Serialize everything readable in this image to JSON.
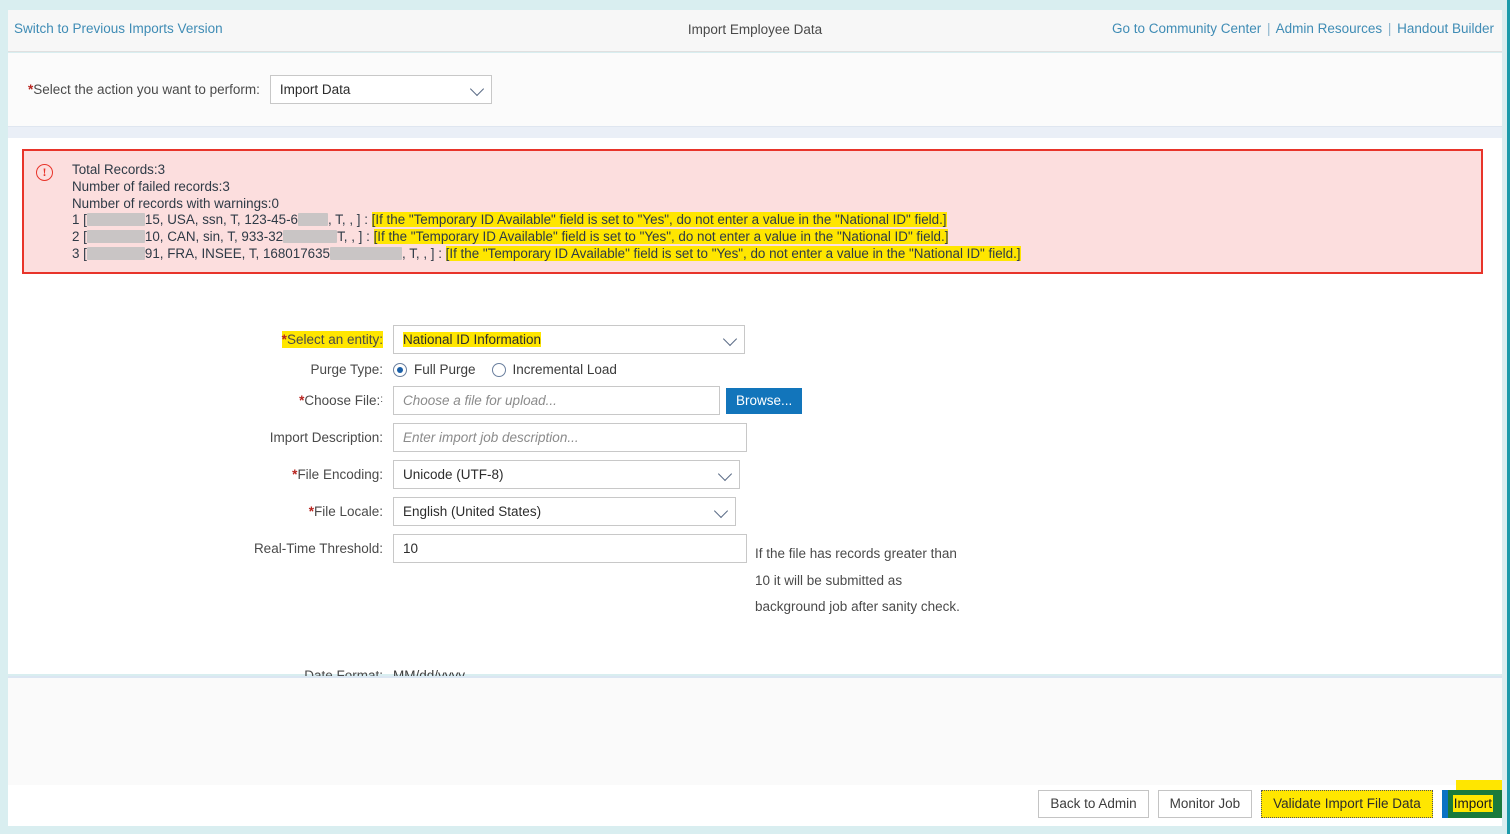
{
  "header": {
    "switch_version_label": "Switch to Previous Imports Version",
    "title": "Import Employee Data",
    "links": [
      {
        "label": "Go to Community Center"
      },
      {
        "label": "Admin Resources"
      },
      {
        "label": "Handout Builder"
      }
    ],
    "separator": "|"
  },
  "action": {
    "required_marker": "*",
    "label": "Select the action you want to perform:",
    "selected": "Import Data"
  },
  "error": {
    "icon": "warning-exclamation-icon",
    "total_records_line": "Total Records:3",
    "failed_records_line": "Number of failed records:3",
    "warning_records_line": "Number of records with warnings:0",
    "message_text": "[If the \"Temporary ID Available\" field is set to \"Yes\", do not enter a value in the \"National ID\" field.]",
    "rows": [
      {
        "index": "1 [",
        "after_redact": "15, USA, ssn, T, 123-45-6",
        "tail": ", T, , ] : ",
        "redact1_width": 58,
        "redact2_width": 30
      },
      {
        "index": "2 [",
        "after_redact": "10, CAN, sin, T, 933-32",
        "tail": "T, , ] : ",
        "redact1_width": 58,
        "redact2_width": 54
      },
      {
        "index": "3 [",
        "after_redact": "91, FRA, INSEE, T, 168017635",
        "tail": ", T, , ] : ",
        "redact1_width": 58,
        "redact2_width": 72
      }
    ]
  },
  "form": {
    "entity": {
      "required_marker": "*",
      "label": "Select an entity:",
      "value": "National ID Information",
      "highlighted": true
    },
    "purge_type": {
      "label": "Purge Type:",
      "options": [
        {
          "label": "Full Purge",
          "selected": true
        },
        {
          "label": "Incremental Load",
          "selected": false
        }
      ]
    },
    "choose_file": {
      "required_marker": "*",
      "label": "Choose File:",
      "label_suffix": ":",
      "placeholder": "Choose a file for upload...",
      "value": "",
      "browse_label": "Browse..."
    },
    "import_description": {
      "label": "Import Description:",
      "placeholder": "Enter import job description...",
      "value": ""
    },
    "file_encoding": {
      "required_marker": "*",
      "label": "File Encoding:",
      "value": "Unicode (UTF-8)"
    },
    "file_locale": {
      "required_marker": "*",
      "label": "File Locale:",
      "value": "English (United States)"
    },
    "real_time_threshold": {
      "label": "Real-Time Threshold:",
      "value": "10",
      "help_line1": "If the file has records greater than",
      "help_line2": "10 it will be submitted as",
      "help_line3": "background job after sanity check."
    },
    "date_format": {
      "label": "Date Format:",
      "value": "MM/dd/yyyy"
    }
  },
  "footer": {
    "back_label": "Back to Admin",
    "monitor_label": "Monitor Job",
    "validate_label": "Validate Import File Data",
    "import_label": "Import"
  },
  "colors": {
    "page_background": "#d9eef0",
    "frame_accent": "#1b9aaa",
    "link": "#3f8cb5",
    "required": "#b8241f",
    "error_border": "#e8342a",
    "error_background": "#fcdede",
    "highlight": "#ffe600",
    "browse_blue": "#1275bb",
    "import_green": "#1a7a3c",
    "import_blue_edge": "#0a72c4",
    "redaction_gray": "#c9c5c5"
  }
}
